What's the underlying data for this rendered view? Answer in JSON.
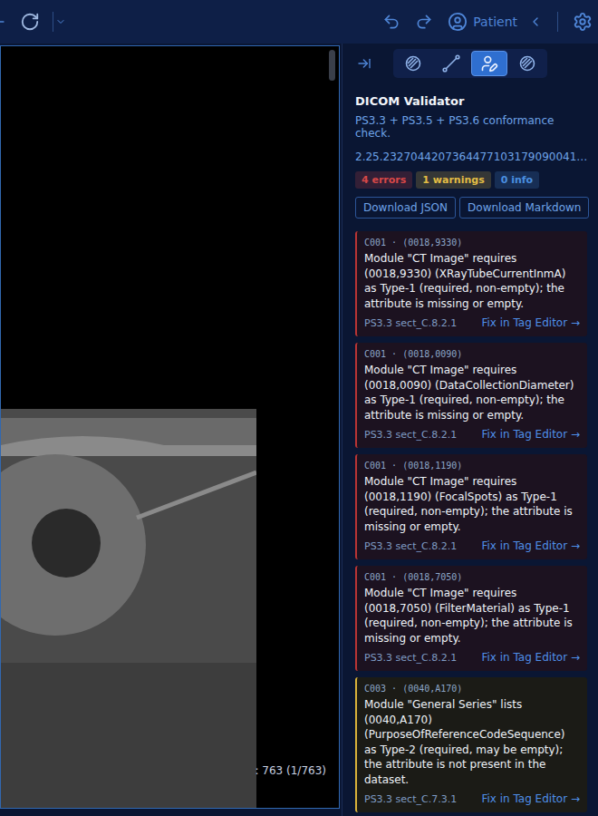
{
  "topbar": {
    "user_label": "Patient"
  },
  "viewer": {
    "overlay": ": 763 (1/763)"
  },
  "panel_tabs": [
    {
      "kind": "hatch",
      "selected": false
    },
    {
      "kind": "measure",
      "selected": false
    },
    {
      "kind": "edit",
      "selected": true
    },
    {
      "kind": "hatch",
      "selected": false
    }
  ],
  "validator": {
    "title": "DICOM Validator",
    "subtitle": "PS3.3 + PS3.5 + PS3.6 conformance check.",
    "uid": "2.25.2327044207364477103179090041…",
    "badges": [
      {
        "label": "4 errors",
        "color": "#d84848"
      },
      {
        "label": "1 warnings",
        "color": "#e2bd45"
      },
      {
        "label": "0 info",
        "color": "#4a8fe0"
      }
    ],
    "buttons": [
      "Download JSON",
      "Download Markdown"
    ],
    "issues": [
      {
        "kind": "error",
        "header": "C001 · (0018,9330)",
        "message": "Module \"CT Image\" requires (0018,9330) (XRayTubeCurrentInmA) as Type-1 (required, non-empty); the attribute is missing or empty.",
        "ref": "PS3.3 sect_C.8.2.1",
        "action": "Fix in Tag Editor →"
      },
      {
        "kind": "error",
        "header": "C001 · (0018,0090)",
        "message": "Module \"CT Image\" requires (0018,0090) (DataCollectionDiameter) as Type-1 (required, non-empty); the attribute is missing or empty.",
        "ref": "PS3.3 sect_C.8.2.1",
        "action": "Fix in Tag Editor →"
      },
      {
        "kind": "error",
        "header": "C001 · (0018,1190)",
        "message": "Module \"CT Image\" requires (0018,1190) (FocalSpots) as Type-1 (required, non-empty); the attribute is missing or empty.",
        "ref": "PS3.3 sect_C.8.2.1",
        "action": "Fix in Tag Editor →"
      },
      {
        "kind": "error",
        "header": "C001 · (0018,7050)",
        "message": "Module \"CT Image\" requires (0018,7050) (FilterMaterial) as Type-1 (required, non-empty); the attribute is missing or empty.",
        "ref": "PS3.3 sect_C.8.2.1",
        "action": "Fix in Tag Editor →"
      },
      {
        "kind": "warning",
        "header": "C003 · (0040,A170)",
        "message": "Module \"General Series\" lists (0040,A170) (PurposeOfReferenceCodeSequence) as Type-2 (required, may be empty); the attribute is not present in the dataset.",
        "ref": "PS3.3 sect_C.7.3.1",
        "action": "Fix in Tag Editor →"
      }
    ]
  }
}
